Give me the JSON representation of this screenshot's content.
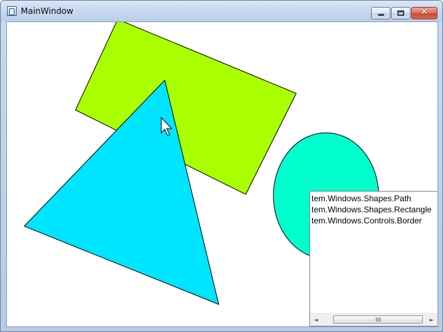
{
  "window": {
    "title": "MainWindow",
    "icon": "wpf-application-icon",
    "buttons": {
      "minimize_icon": "minimize-icon",
      "maximize_icon": "maximize-icon",
      "close_icon": "close-icon",
      "close_glyph": "✕"
    }
  },
  "shapes": [
    {
      "kind": "Rectangle",
      "fill": "#AAFF00",
      "stroke": "#000000"
    },
    {
      "kind": "Path",
      "fill": "#00E5FF",
      "stroke": "#000000"
    },
    {
      "kind": "Ellipse",
      "fill": "#00FFCC",
      "stroke": "#000000"
    }
  ],
  "listbox": {
    "items": [
      "tem.Windows.Shapes.Path",
      "tem.Windows.Shapes.Rectangle",
      "tem.Windows.Controls.Border"
    ],
    "scroll_left_icon": "◄",
    "scroll_right_icon": "►"
  },
  "cursor": {
    "icon": "arrow-cursor-icon"
  }
}
